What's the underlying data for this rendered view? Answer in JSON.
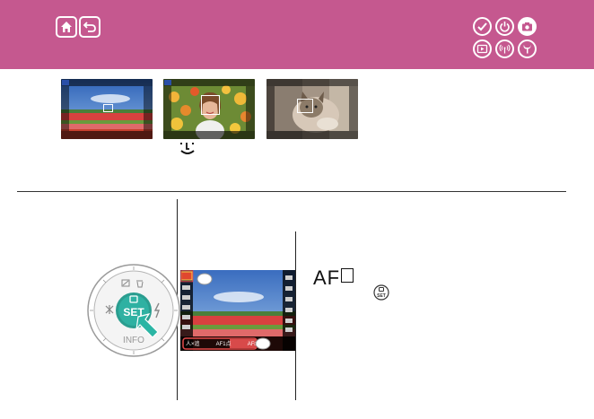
{
  "header": {
    "background": "#c5588f",
    "nav_icons": [
      "home-icon",
      "back-icon"
    ],
    "category_icons": [
      "check-icon",
      "power-icon",
      "camera-icon",
      "playback-icon",
      "wireless-icon",
      "tools-icon"
    ],
    "active_category": "camera-icon"
  },
  "thumbnails": [
    {
      "name": "landscape-thumbnail",
      "mode_label": "P"
    },
    {
      "name": "portrait-thumbnail",
      "mode_label": "P"
    },
    {
      "name": "cat-thumbnail",
      "mode_label": ""
    }
  ],
  "face_detect_icon": "face-tracking-icon",
  "dial": {
    "center_label": "SET",
    "bottom_label": "INFO",
    "icons": [
      "exposure-comp-icon",
      "trash-icon",
      "macro-icon",
      "flash-icon",
      "quick-menu-icon"
    ]
  },
  "screen": {
    "bottom_options": [
      "人×追",
      "AF1点",
      "AF□"
    ]
  },
  "af_section": {
    "title": "AF",
    "set_icon": "set-button-icon"
  }
}
